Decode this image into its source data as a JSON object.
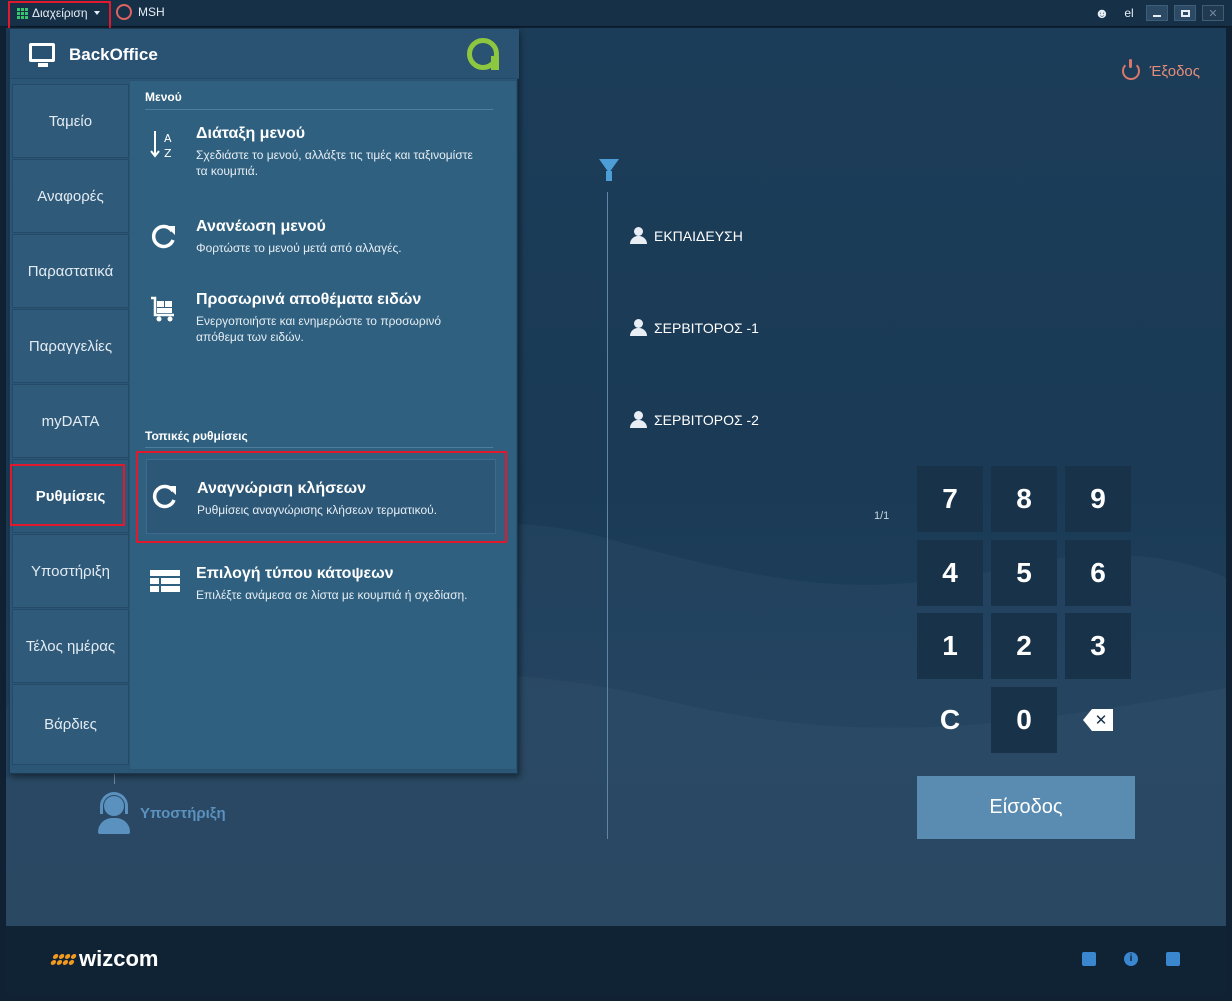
{
  "titlebar": {
    "menu_label": "Διαχείριση",
    "station_label": "MSH",
    "lang": "el"
  },
  "colors": {
    "accent_green": "#36c66d",
    "highlight_red": "#e0192c",
    "brand_orange": "#f39a1e",
    "exit_color": "#e58d7a"
  },
  "main": {
    "exit_label": "Έξοδος",
    "users": [
      "ΕΚΠΑΙΔΕΥΣΗ",
      "ΣΕΡΒΙΤΟΡΟΣ -1",
      "ΣΕΡΒΙΤΟΡΟΣ -2"
    ],
    "pager": "1/1",
    "keypad": [
      "7",
      "8",
      "9",
      "4",
      "5",
      "6",
      "1",
      "2",
      "3",
      "C",
      "0"
    ],
    "login_label": "Είσοδος",
    "support_label": "Υποστήριξη"
  },
  "panel": {
    "title": "BackOffice",
    "sidebar": [
      {
        "label": "Ταμείο"
      },
      {
        "label": "Αναφορές"
      },
      {
        "label": "Παραστατικά"
      },
      {
        "label": "Παραγγελίες"
      },
      {
        "label": "myDATA"
      },
      {
        "label": "Ρυθμίσεις",
        "active": true
      },
      {
        "label": "Υποστήριξη"
      },
      {
        "label": "Τέλος ημέρας"
      },
      {
        "label": "Βάρδιες"
      }
    ],
    "section_menu": "Μενού",
    "section_local": "Τοπικές ρυθμίσεις",
    "entries": [
      {
        "title": "Διάταξη μενού",
        "desc": "Σχεδιάστε το μενού, αλλάξτε τις τιμές και ταξινομίστε τα κουμπιά.",
        "icon": "sort-az-icon"
      },
      {
        "title": "Ανανέωση μενού",
        "desc": "Φορτώστε το μενού μετά από αλλαγές.",
        "icon": "refresh-icon"
      },
      {
        "title": "Προσωρινά αποθέματα ειδών",
        "desc": "Ενεργοποιήστε και ενημερώστε το προσωρινό απόθεμα των ειδών.",
        "icon": "cart-icon"
      },
      {
        "title": "Αναγνώριση κλήσεων",
        "desc": "Ρυθμίσεις αναγνώρισης κλήσεων τερματικού.",
        "icon": "refresh-icon"
      },
      {
        "title": "Επιλογή τύπου κάτοψεων",
        "desc": "Επιλέξτε ανάμεσα σε λίστα με κουμπιά ή σχεδίαση.",
        "icon": "table-icon"
      }
    ]
  },
  "footer": {
    "brand": "wizcom"
  }
}
